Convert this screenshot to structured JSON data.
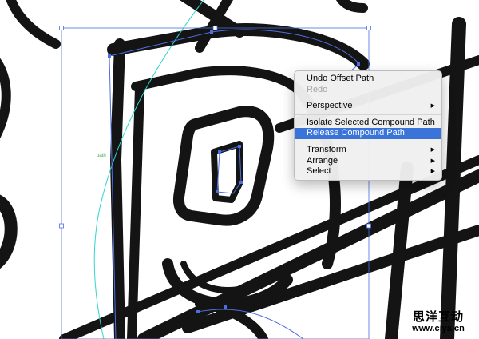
{
  "context_menu": {
    "undo": "Undo Offset Path",
    "redo": "Redo",
    "perspective": "Perspective",
    "isolate": "Isolate Selected Compound Path",
    "release": "Release Compound Path",
    "transform": "Transform",
    "arrange": "Arrange",
    "select": "Select"
  },
  "canvas": {
    "path_hint": "path"
  },
  "watermark": {
    "chinese": "思洋互动",
    "url": "www.ciya.cn"
  },
  "colors": {
    "selection": "#4d6fe0",
    "guide": "#2fd6cc",
    "highlight": "#3b74d9",
    "ink": "#141414"
  }
}
